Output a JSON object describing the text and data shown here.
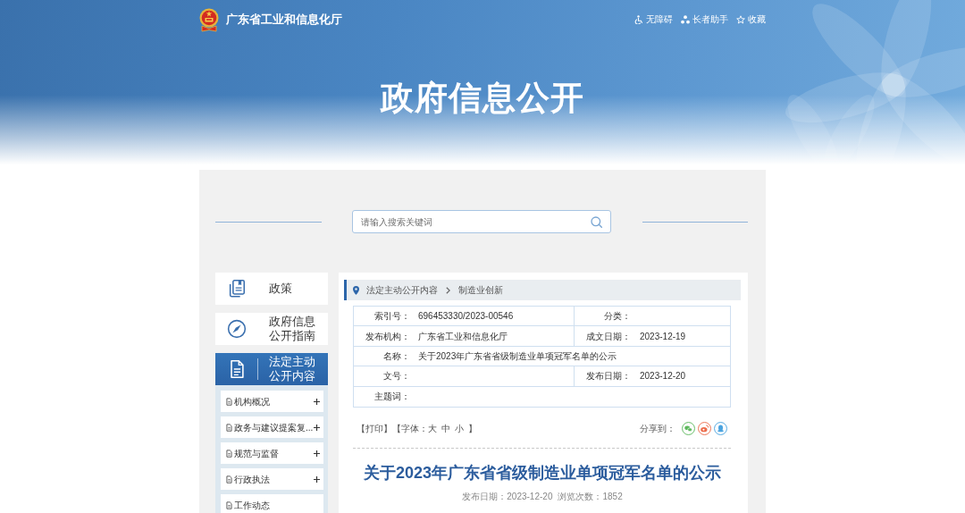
{
  "header": {
    "site_title": "广东省工业和信息化厅",
    "links": [
      {
        "kind": "accessibility",
        "label": "无障碍"
      },
      {
        "kind": "elderly",
        "label": "长者助手"
      },
      {
        "kind": "bookmark",
        "label": "收藏"
      }
    ]
  },
  "banner": {
    "title": "政府信息公开"
  },
  "search": {
    "placeholder": "请输入搜索关键词"
  },
  "sidebar": {
    "items": [
      {
        "kind": "policy",
        "label": "政策",
        "selected": false
      },
      {
        "kind": "guide",
        "label": "政府信息公开指南",
        "selected": false
      },
      {
        "kind": "disclosure",
        "label": "法定主动公开内容",
        "selected": true,
        "children": [
          {
            "label": "机构概况",
            "expanded": false
          },
          {
            "label": "政务与建议提案复...",
            "expanded": false
          },
          {
            "label": "规范与监督",
            "expanded": false
          },
          {
            "label": "行政执法",
            "expanded": false
          },
          {
            "label": "工作动态"
          }
        ]
      }
    ]
  },
  "breadcrumb": [
    "法定主动公开内容",
    "制造业创新"
  ],
  "info_table": {
    "rows": [
      {
        "cells": [
          {
            "label": "索引号：",
            "value": "696453330/2023-00546"
          },
          {
            "label": "分类："
          }
        ]
      },
      {
        "cells": [
          {
            "label": "发布机构：",
            "value": "广东省工业和信息化厅"
          },
          {
            "label": "成文日期：",
            "value": "2023-12-19"
          }
        ]
      },
      {
        "cells": [
          {
            "label": "名称：",
            "value": "关于2023年广东省省级制造业单项冠军名单的公示"
          }
        ]
      },
      {
        "cells": [
          {
            "label": "文号："
          },
          {
            "label": "发布日期：",
            "value": "2023-12-20"
          }
        ]
      },
      {
        "cells": [
          {
            "label": "主题词："
          }
        ]
      }
    ]
  },
  "tools": {
    "print": "【打印】",
    "font_size": {
      "prefix": "【字体：",
      "options": [
        "大",
        "中",
        "小"
      ],
      "suffix": "】"
    },
    "share_label": "分享到：",
    "share": [
      {
        "kind": "chat"
      },
      {
        "kind": "blog"
      },
      {
        "kind": "messenger"
      }
    ]
  },
  "article": {
    "title": "关于2023年广东省省级制造业单项冠军名单的公示",
    "meta": [
      "发布日期：2023-12-20",
      "浏览次数：1852"
    ]
  }
}
